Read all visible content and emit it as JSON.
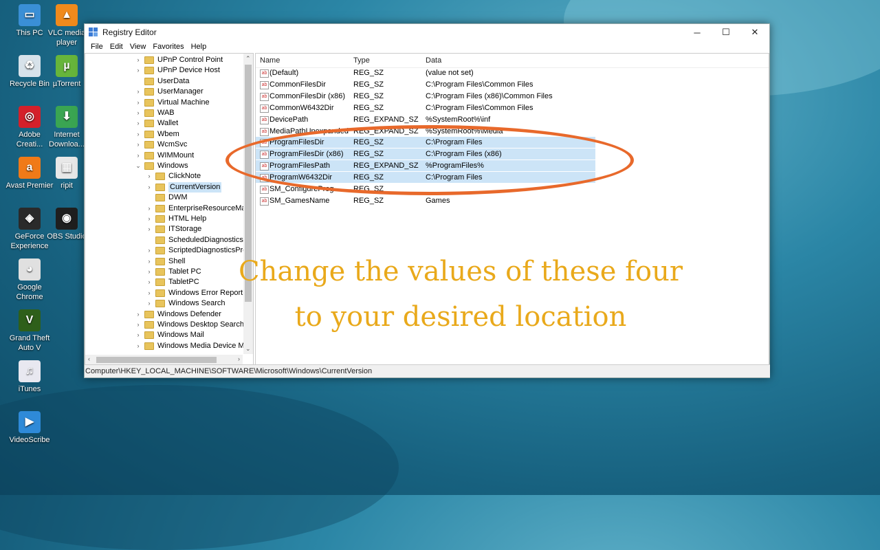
{
  "desktop_icons": [
    {
      "label": "This PC",
      "color": "#3a8fd6",
      "glyph": "▭"
    },
    {
      "label": "VLC media player",
      "color": "#f08a1c",
      "glyph": "▲"
    },
    {
      "label": "Recycle Bin",
      "color": "#d7e2ea",
      "glyph": "♻"
    },
    {
      "label": "µTorrent",
      "color": "#67b53b",
      "glyph": "µ"
    },
    {
      "label": "Adobe Creati...",
      "color": "#d4202a",
      "glyph": "◎"
    },
    {
      "label": "Internet Downloa...",
      "color": "#3aa552",
      "glyph": "⬇"
    },
    {
      "label": "Avast Premier",
      "color": "#f07a18",
      "glyph": "a"
    },
    {
      "label": "ripit",
      "color": "#e8e8e8",
      "glyph": "▦"
    },
    {
      "label": "GeForce Experience",
      "color": "#2a2a2a",
      "glyph": "◈"
    },
    {
      "label": "OBS Studio",
      "color": "#1f1f1f",
      "glyph": "◉"
    },
    {
      "label": "Google Chrome",
      "color": "#e0e0e0",
      "glyph": "◕"
    },
    {
      "label": "Grand Theft Auto V",
      "color": "#2e5f1a",
      "glyph": "V"
    },
    {
      "label": "iTunes",
      "color": "#e8e8f0",
      "glyph": "♫"
    },
    {
      "label": "VideoScribe",
      "color": "#2e8ad8",
      "glyph": "▶"
    }
  ],
  "window": {
    "title": "Registry Editor",
    "controls": {
      "minimize": "─",
      "maximize": "☐",
      "close": "✕"
    },
    "menu": [
      "File",
      "Edit",
      "View",
      "Favorites",
      "Help"
    ]
  },
  "tree": [
    {
      "label": "UPnP Control Point",
      "indent": 1,
      "expand": "›",
      "sel": false
    },
    {
      "label": "UPnP Device Host",
      "indent": 1,
      "expand": "›",
      "sel": false
    },
    {
      "label": "UserData",
      "indent": 1,
      "expand": "",
      "sel": false
    },
    {
      "label": "UserManager",
      "indent": 1,
      "expand": "›",
      "sel": false
    },
    {
      "label": "Virtual Machine",
      "indent": 1,
      "expand": "›",
      "sel": false
    },
    {
      "label": "WAB",
      "indent": 1,
      "expand": "›",
      "sel": false
    },
    {
      "label": "Wallet",
      "indent": 1,
      "expand": "›",
      "sel": false
    },
    {
      "label": "Wbem",
      "indent": 1,
      "expand": "›",
      "sel": false
    },
    {
      "label": "WcmSvc",
      "indent": 1,
      "expand": "›",
      "sel": false
    },
    {
      "label": "WIMMount",
      "indent": 1,
      "expand": "›",
      "sel": false
    },
    {
      "label": "Windows",
      "indent": 1,
      "expand": "⌄",
      "sel": false
    },
    {
      "label": "ClickNote",
      "indent": 2,
      "expand": "›",
      "sel": false
    },
    {
      "label": "CurrentVersion",
      "indent": 2,
      "expand": "›",
      "sel": true
    },
    {
      "label": "DWM",
      "indent": 2,
      "expand": "",
      "sel": false
    },
    {
      "label": "EnterpriseResourceMana",
      "indent": 2,
      "expand": "›",
      "sel": false
    },
    {
      "label": "HTML Help",
      "indent": 2,
      "expand": "›",
      "sel": false
    },
    {
      "label": "ITStorage",
      "indent": 2,
      "expand": "›",
      "sel": false
    },
    {
      "label": "ScheduledDiagnostics",
      "indent": 2,
      "expand": "",
      "sel": false
    },
    {
      "label": "ScriptedDiagnosticsProv",
      "indent": 2,
      "expand": "›",
      "sel": false
    },
    {
      "label": "Shell",
      "indent": 2,
      "expand": "›",
      "sel": false
    },
    {
      "label": "Tablet PC",
      "indent": 2,
      "expand": "›",
      "sel": false
    },
    {
      "label": "TabletPC",
      "indent": 2,
      "expand": "›",
      "sel": false
    },
    {
      "label": "Windows Error Reportin",
      "indent": 2,
      "expand": "›",
      "sel": false
    },
    {
      "label": "Windows Search",
      "indent": 2,
      "expand": "›",
      "sel": false
    },
    {
      "label": "Windows Defender",
      "indent": 1,
      "expand": "›",
      "sel": false
    },
    {
      "label": "Windows Desktop Search",
      "indent": 1,
      "expand": "›",
      "sel": false
    },
    {
      "label": "Windows Mail",
      "indent": 1,
      "expand": "›",
      "sel": false
    },
    {
      "label": "Windows Media Device Ma",
      "indent": 1,
      "expand": "›",
      "sel": false
    }
  ],
  "list": {
    "headers": {
      "name": "Name",
      "type": "Type",
      "data": "Data"
    },
    "rows": [
      {
        "name": "(Default)",
        "type": "REG_SZ",
        "data": "(value not set)",
        "hl": false
      },
      {
        "name": "CommonFilesDir",
        "type": "REG_SZ",
        "data": "C:\\Program Files\\Common Files",
        "hl": false
      },
      {
        "name": "CommonFilesDir (x86)",
        "type": "REG_SZ",
        "data": "C:\\Program Files (x86)\\Common Files",
        "hl": false
      },
      {
        "name": "CommonW6432Dir",
        "type": "REG_SZ",
        "data": "C:\\Program Files\\Common Files",
        "hl": false
      },
      {
        "name": "DevicePath",
        "type": "REG_EXPAND_SZ",
        "data": "%SystemRoot%\\inf",
        "hl": false
      },
      {
        "name": "MediaPathUnexpanded",
        "type": "REG_EXPAND_SZ",
        "data": "%SystemRoot%\\Media",
        "hl": false
      },
      {
        "name": "ProgramFilesDir",
        "type": "REG_SZ",
        "data": "C:\\Program Files",
        "hl": true
      },
      {
        "name": "ProgramFilesDir (x86)",
        "type": "REG_SZ",
        "data": "C:\\Program Files (x86)",
        "hl": true
      },
      {
        "name": "ProgramFilesPath",
        "type": "REG_EXPAND_SZ",
        "data": "%ProgramFiles%",
        "hl": true
      },
      {
        "name": "ProgramW6432Dir",
        "type": "REG_SZ",
        "data": "C:\\Program Files",
        "hl": true
      },
      {
        "name": "SM_ConfigureProg",
        "type": "REG_SZ",
        "data": "",
        "hl": false
      },
      {
        "name": "SM_GamesName",
        "type": "REG_SZ",
        "data": "Games",
        "hl": false
      }
    ]
  },
  "status_path": "Computer\\HKEY_LOCAL_MACHINE\\SOFTWARE\\Microsoft\\Windows\\CurrentVersion",
  "annotation": {
    "line1": "Change the values of these four",
    "line2": "to your desired location",
    "color": "#e9a91b",
    "circle_color": "#e8692b"
  }
}
